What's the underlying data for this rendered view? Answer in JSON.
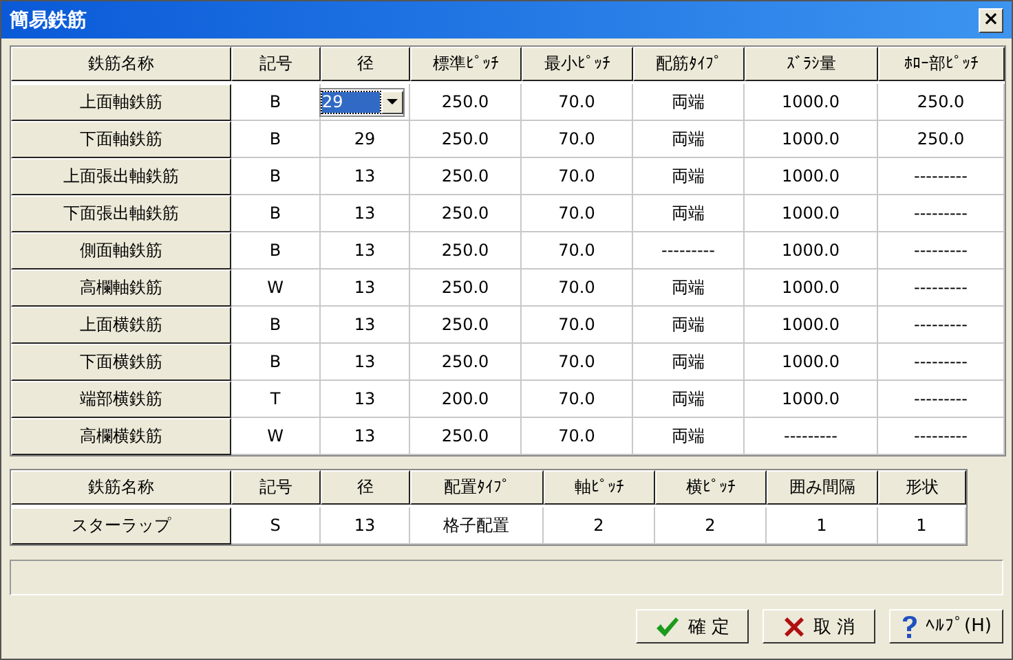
{
  "window": {
    "title": "簡易鉄筋",
    "close": "×"
  },
  "main_table": {
    "columns": [
      "鉄筋名称",
      "記号",
      "径",
      "標準ﾋﾟｯﾁ",
      "最小ﾋﾟｯﾁ",
      "配筋ﾀｲﾌﾟ",
      "ｽﾞﾗｼ量",
      "ﾎﾛｰ部ﾋﾟｯﾁ"
    ],
    "rows": [
      {
        "cells": [
          "上面軸鉄筋",
          "B",
          "29",
          "250.0",
          "70.0",
          "両端",
          "1000.0",
          "250.0"
        ],
        "dropdown_open_on_diameter": true
      },
      {
        "cells": [
          "下面軸鉄筋",
          "B",
          "29",
          "250.0",
          "70.0",
          "両端",
          "1000.0",
          "250.0"
        ],
        "dropdown_open_on_diameter": false
      },
      {
        "cells": [
          "上面張出軸鉄筋",
          "B",
          "13",
          "250.0",
          "70.0",
          "両端",
          "1000.0",
          "---------"
        ],
        "dropdown_open_on_diameter": false
      },
      {
        "cells": [
          "下面張出軸鉄筋",
          "B",
          "13",
          "250.0",
          "70.0",
          "両端",
          "1000.0",
          "---------"
        ],
        "dropdown_open_on_diameter": false
      },
      {
        "cells": [
          "側面軸鉄筋",
          "B",
          "13",
          "250.0",
          "70.0",
          "---------",
          "1000.0",
          "---------"
        ],
        "dropdown_open_on_diameter": false
      },
      {
        "cells": [
          "高欄軸鉄筋",
          "W",
          "13",
          "250.0",
          "70.0",
          "両端",
          "1000.0",
          "---------"
        ],
        "dropdown_open_on_diameter": false
      },
      {
        "cells": [
          "上面横鉄筋",
          "B",
          "13",
          "250.0",
          "70.0",
          "両端",
          "1000.0",
          "---------"
        ],
        "dropdown_open_on_diameter": false
      },
      {
        "cells": [
          "下面横鉄筋",
          "B",
          "13",
          "250.0",
          "70.0",
          "両端",
          "1000.0",
          "---------"
        ],
        "dropdown_open_on_diameter": false
      },
      {
        "cells": [
          "端部横鉄筋",
          "T",
          "13",
          "200.0",
          "70.0",
          "両端",
          "1000.0",
          "---------"
        ],
        "dropdown_open_on_diameter": false
      },
      {
        "cells": [
          "高欄横鉄筋",
          "W",
          "13",
          "250.0",
          "70.0",
          "両端",
          "---------",
          "---------"
        ],
        "dropdown_open_on_diameter": false
      }
    ]
  },
  "stirrup_table": {
    "columns": [
      "鉄筋名称",
      "記号",
      "径",
      "配置ﾀｲﾌﾟ",
      "軸ﾋﾟｯﾁ",
      "横ﾋﾟｯﾁ",
      "囲み間隔",
      "形状"
    ],
    "rows": [
      {
        "cells": [
          "スターラップ",
          "S",
          "13",
          "格子配置",
          "2",
          "2",
          "1",
          "1"
        ]
      }
    ]
  },
  "buttons": [
    {
      "kind": "ok",
      "label": "確 定"
    },
    {
      "kind": "cancel",
      "label": "取 消"
    },
    {
      "kind": "help",
      "label": "ﾍﾙﾌﾟ(H)"
    }
  ]
}
